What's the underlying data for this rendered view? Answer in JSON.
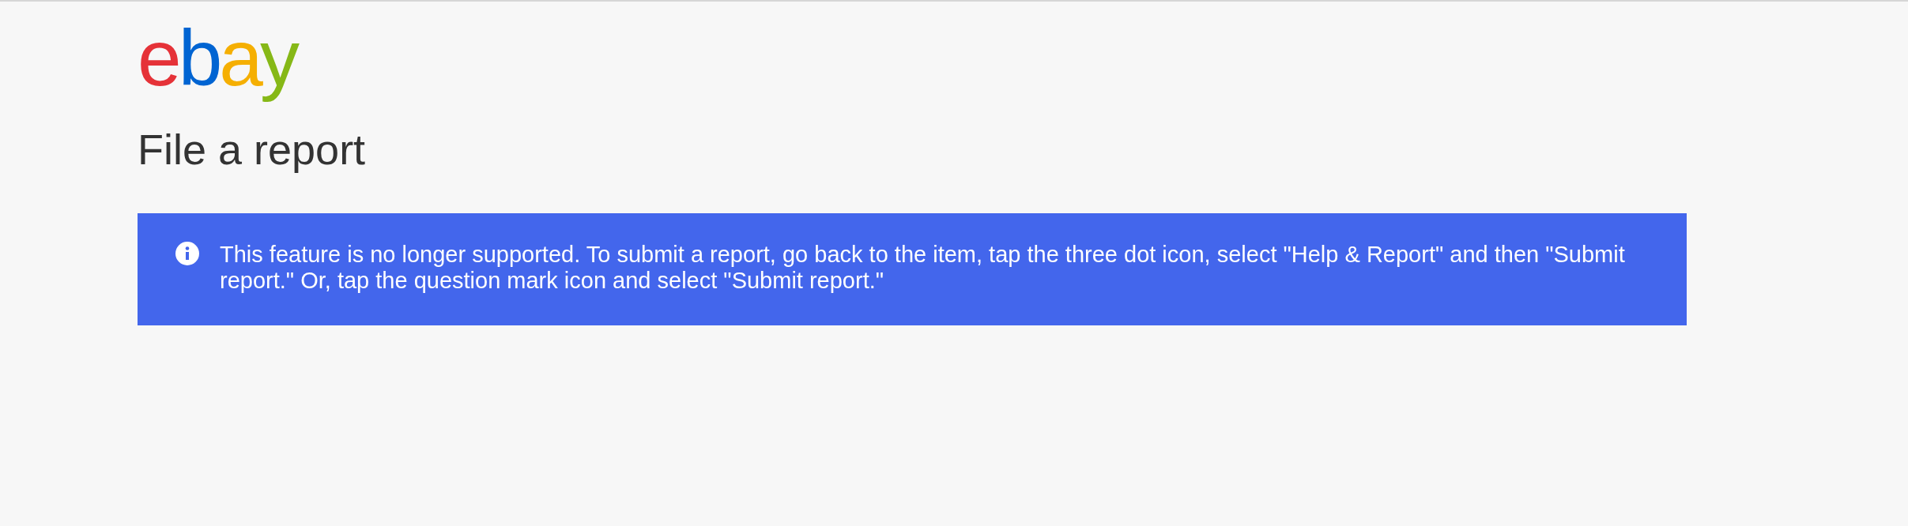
{
  "logo": {
    "letters": [
      {
        "char": "e",
        "color": "#e53238"
      },
      {
        "char": "b",
        "color": "#0064d2"
      },
      {
        "char": "a",
        "color": "#f5af02"
      },
      {
        "char": "y",
        "color": "#86b817"
      }
    ]
  },
  "title": "File a report",
  "notice": {
    "kind": "info",
    "text": "This feature is no longer supported. To submit a report, go back to the item, tap the three dot icon, select \"Help & Report\" and then \"Submit report.\" Or, tap the question mark icon and select \"Submit report.\""
  }
}
